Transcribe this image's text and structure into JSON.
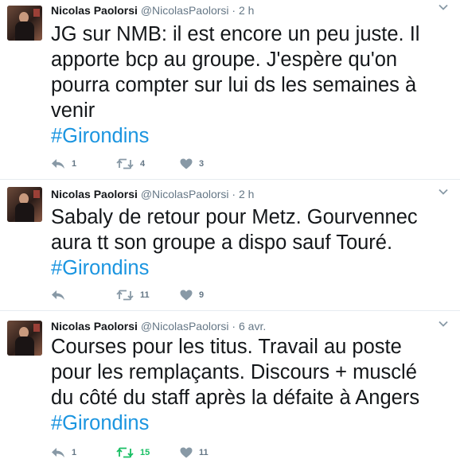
{
  "tweets": [
    {
      "author_name": "Nicolas Paolorsi",
      "author_handle": "@NicolasPaolorsi",
      "separator": "·",
      "time": "2 h",
      "lines": [
        "JG sur NMB: il est encore un peu juste. Il",
        "apporte bcp au groupe. J'espère qu'on",
        "pourra compter sur lui ds les semaines à",
        "venir"
      ],
      "hashtag": "#Girondins",
      "reply_count": "1",
      "retweet_count": "4",
      "like_count": "3",
      "retweeted": false
    },
    {
      "author_name": "Nicolas Paolorsi",
      "author_handle": "@NicolasPaolorsi",
      "separator": "·",
      "time": "2 h",
      "lines": [
        "Sabaly de retour pour Metz. Gourvennec",
        "aura tt son groupe a dispo sauf Touré."
      ],
      "hashtag": "#Girondins",
      "reply_count": "",
      "retweet_count": "11",
      "like_count": "9",
      "retweeted": false
    },
    {
      "author_name": "Nicolas Paolorsi",
      "author_handle": "@NicolasPaolorsi",
      "separator": "·",
      "time": "6 avr.",
      "lines": [
        "Courses pour les titus. Travail au poste",
        "pour les remplaçants. Discours + musclé",
        "du côté du staff après la défaite à Angers"
      ],
      "hashtag": "#Girondins",
      "reply_count": "1",
      "retweet_count": "15",
      "like_count": "11",
      "retweeted": true
    }
  ],
  "icons": {
    "avatar": "profile-photo",
    "menu": "chevron-down-icon",
    "reply": "reply-icon",
    "retweet": "retweet-icon",
    "like": "heart-icon"
  },
  "colors": {
    "text": "#14171a",
    "secondary": "#657786",
    "hashtag": "#1b95e0",
    "retweet_active": "#17bf63",
    "divider": "#e6ecf0"
  }
}
